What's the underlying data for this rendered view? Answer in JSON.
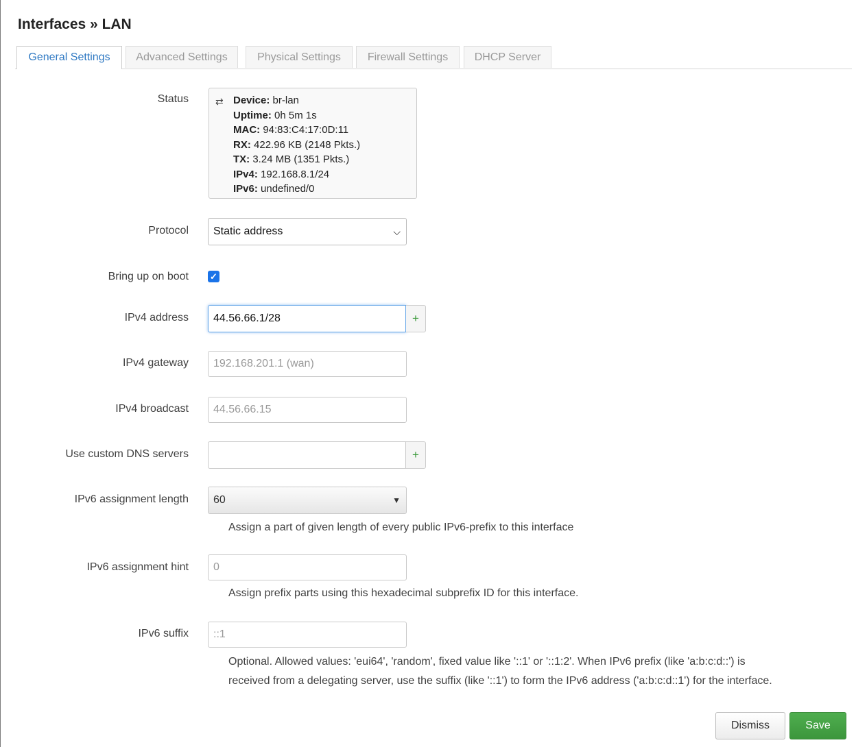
{
  "page_title": "Interfaces » LAN",
  "tabs": [
    {
      "label": "General Settings",
      "active": true
    },
    {
      "label": "Advanced Settings",
      "active": false
    },
    {
      "label": "Physical Settings",
      "active": false
    },
    {
      "label": "Firewall Settings",
      "active": false
    },
    {
      "label": "DHCP Server",
      "active": false
    }
  ],
  "status": {
    "label": "Status",
    "device_key": "Device:",
    "device_val": "br-lan",
    "uptime_key": "Uptime:",
    "uptime_val": "0h 5m 1s",
    "mac_key": "MAC:",
    "mac_val": "94:83:C4:17:0D:11",
    "rx_key": "RX:",
    "rx_val": "422.96 KB (2148 Pkts.)",
    "tx_key": "TX:",
    "tx_val": "3.24 MB (1351 Pkts.)",
    "ipv4_key": "IPv4:",
    "ipv4_val": "192.168.8.1/24",
    "ipv6_key": "IPv6:",
    "ipv6_val": "undefined/0"
  },
  "protocol": {
    "label": "Protocol",
    "selected": "Static address"
  },
  "boot": {
    "label": "Bring up on boot",
    "checked": true
  },
  "ipv4_address": {
    "label": "IPv4 address",
    "value": "44.56.66.1/28",
    "add": "+"
  },
  "ipv4_gateway": {
    "label": "IPv4 gateway",
    "placeholder": "192.168.201.1 (wan)"
  },
  "ipv4_broadcast": {
    "label": "IPv4 broadcast",
    "placeholder": "44.56.66.15"
  },
  "dns": {
    "label": "Use custom DNS servers",
    "value": "",
    "add": "+"
  },
  "ipv6_len": {
    "label": "IPv6 assignment length",
    "value": "60",
    "desc": "Assign a part of given length of every public IPv6-prefix to this interface"
  },
  "ipv6_hint": {
    "label": "IPv6 assignment hint",
    "placeholder": "0",
    "desc": "Assign prefix parts using this hexadecimal subprefix ID for this interface."
  },
  "ipv6_suffix": {
    "label": "IPv6 suffix",
    "placeholder": "::1",
    "desc1": "Optional. Allowed values: 'eui64', 'random', fixed value like '::1' or '::1:2'. When IPv6 prefix (like 'a:b:c:d::') is",
    "desc2": "received from a delegating server, use the suffix (like '::1') to form the IPv6 address ('a:b:c:d::1') for the interface."
  },
  "buttons": {
    "dismiss": "Dismiss",
    "save": "Save"
  },
  "colors": {
    "accent": "#2f79c3",
    "save": "#3c963c",
    "checkbox": "#1a73e8"
  }
}
